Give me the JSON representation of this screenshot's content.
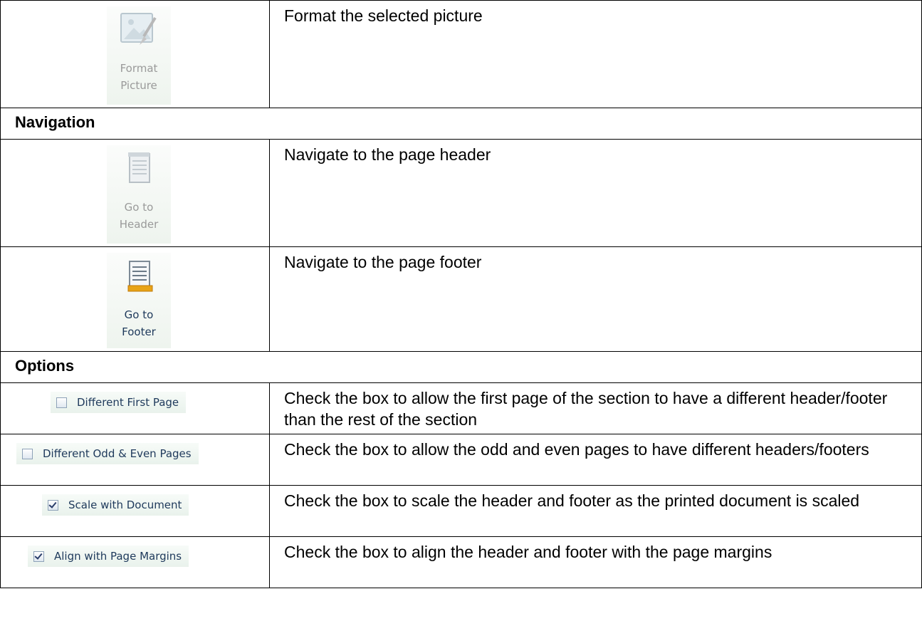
{
  "rows": {
    "format_picture": {
      "button_label_line1": "Format",
      "button_label_line2": "Picture",
      "icon": "format-picture-icon",
      "description": "Format the selected picture"
    },
    "navigation": {
      "heading": "Navigation"
    },
    "go_to_header": {
      "button_label_line1": "Go to",
      "button_label_line2": "Header",
      "icon": "page-header-icon",
      "description": "Navigate to the page header"
    },
    "go_to_footer": {
      "button_label_line1": "Go to",
      "button_label_line2": "Footer",
      "icon": "page-footer-icon",
      "description": "Navigate to the page footer"
    },
    "options": {
      "heading": "Options"
    },
    "different_first_page": {
      "label": "Different First Page",
      "checked": false,
      "description": "Check the box to allow the first page of the section to have a different header/footer than the rest of the section"
    },
    "different_odd_even": {
      "label": "Different Odd & Even Pages",
      "checked": false,
      "description": "Check the box to allow the odd and even pages to have different headers/footers"
    },
    "scale_with_document": {
      "label": "Scale with Document",
      "checked": true,
      "description": "Check the box to scale the header and footer as the printed document is scaled"
    },
    "align_with_margins": {
      "label": "Align with Page Margins",
      "checked": true,
      "description": "Check the box to align the header and footer with the page margins"
    }
  },
  "colors": {
    "ribbon_label_active": "#1e395b",
    "ribbon_label_disabled": "#9a9a9a",
    "footer_accent": "#e8a317"
  }
}
